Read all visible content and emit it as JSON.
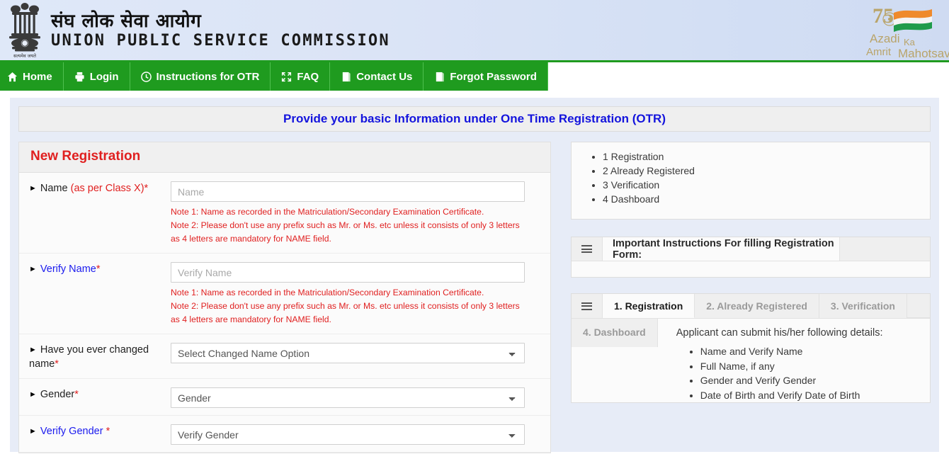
{
  "header": {
    "title_hindi": "संघ लोक सेवा आयोग",
    "title_english": "UNION PUBLIC SERVICE COMMISSION",
    "emblem_motto": "सत्यमेव जयते",
    "logo": {
      "numeral": "75",
      "line1": "Azadi",
      "line2": "Ka",
      "line3": "Amrit",
      "line4": "Mahotsav"
    },
    "colors": {
      "nav_green": "#1f9b1f",
      "header_blue": "#dce6f7"
    }
  },
  "nav": {
    "items": [
      {
        "label": "Home",
        "icon": "home-icon"
      },
      {
        "label": "Login",
        "icon": "login-icon"
      },
      {
        "label": "Instructions for OTR",
        "icon": "clock-icon"
      },
      {
        "label": "FAQ",
        "icon": "expand-icon"
      },
      {
        "label": "Contact Us",
        "icon": "book-icon"
      },
      {
        "label": "Forgot Password",
        "icon": "book-icon"
      }
    ]
  },
  "banner": {
    "text": "Provide your basic Information under One Time Registration (OTR)",
    "color": "#1414dd"
  },
  "registration": {
    "panel_title": "New Registration",
    "panel_title_color": "#e02020",
    "note1": "Note 1: Name as recorded in the Matriculation/Secondary Examination Certificate.",
    "note2_line1": "Note 2: Please don't use any prefix such as Mr. or Ms. etc unless it consists of only 3 letters",
    "note2_line2": "as 4 letters are mandatory for NAME field.",
    "fields": {
      "name": {
        "label_main": "Name ",
        "label_highlight": "(as per Class X)*",
        "placeholder": "Name",
        "value": ""
      },
      "verify_name": {
        "label_main": "Verify Name",
        "required_mark": "*",
        "placeholder": "Verify Name",
        "value": ""
      },
      "changed_name": {
        "label_line1": "Have you ever changed",
        "label_line2": "name",
        "required_mark": "*",
        "selected": "Select Changed Name Option"
      },
      "gender": {
        "label_main": "Gender",
        "required_mark": "*",
        "selected": "Gender"
      },
      "verify_gender": {
        "label_main": "Verify Gender ",
        "required_mark": "*",
        "selected": "Verify Gender"
      }
    }
  },
  "steps_box": {
    "items": [
      "1 Registration",
      "2 Already Registered",
      "3 Verification",
      "4 Dashboard"
    ]
  },
  "instructions": {
    "title": "Important Instructions For filling Registration Form:",
    "menu_icon": "hamburger-icon"
  },
  "tabs_panel": {
    "menu_icon": "hamburger-icon",
    "tabs": [
      {
        "label": "1. Registration",
        "active": true
      },
      {
        "label": "2. Already Registered",
        "active": false
      },
      {
        "label": "3. Verification",
        "active": false
      },
      {
        "label": "4. Dashboard",
        "active": false
      }
    ],
    "content": {
      "intro": "Applicant can submit his/her following details:",
      "bullets": [
        "Name and Verify Name",
        "Full Name, if any",
        "Gender and Verify Gender",
        "Date of Birth and Verify Date of Birth"
      ]
    }
  }
}
